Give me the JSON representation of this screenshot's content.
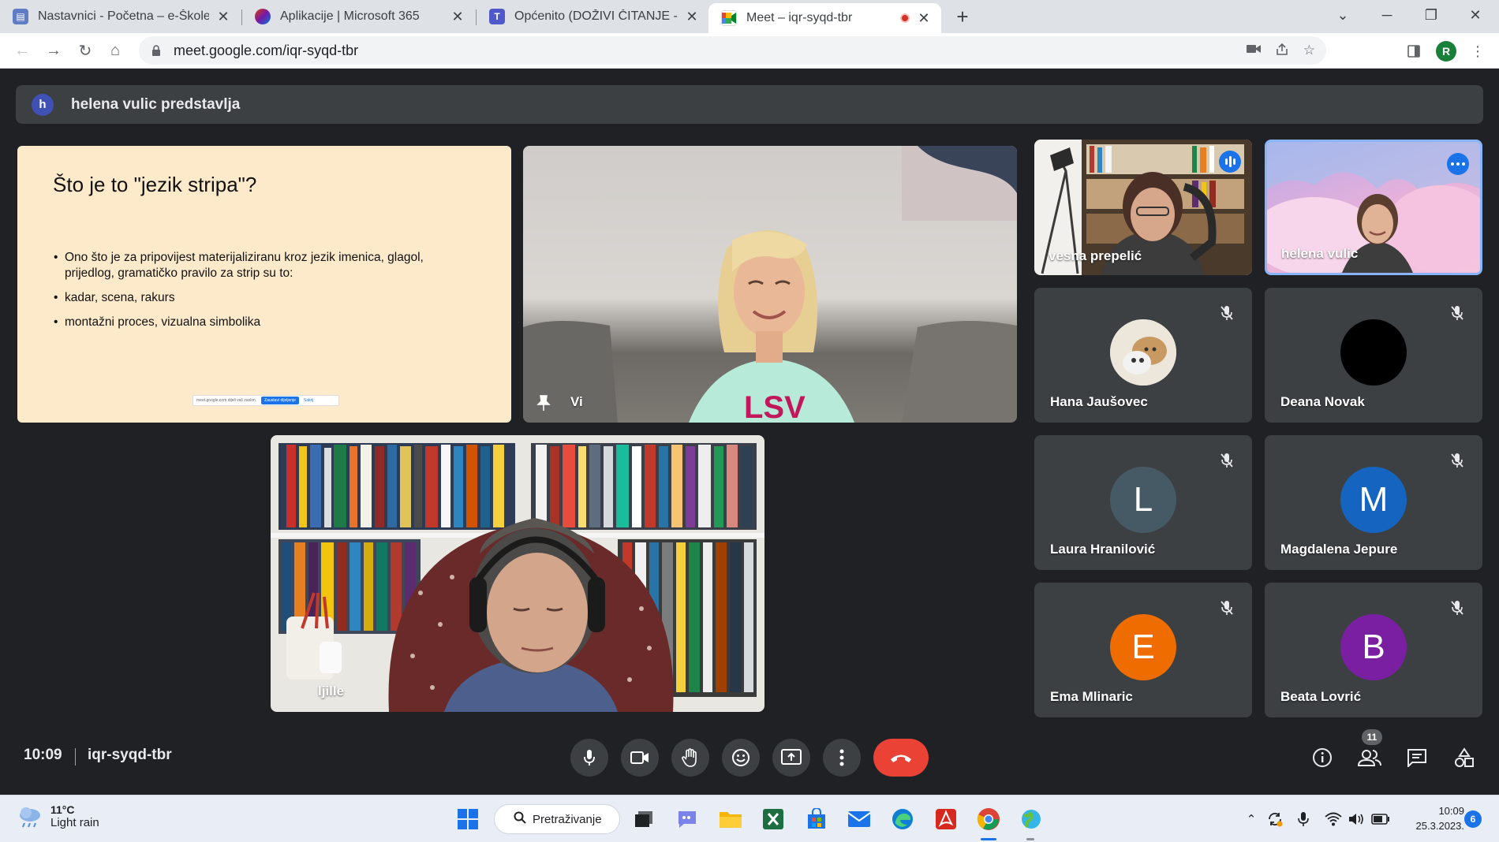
{
  "browser": {
    "tabs": [
      {
        "title": "Nastavnici - Početna – e-Škole",
        "active": false
      },
      {
        "title": "Aplikacije | Microsoft 365",
        "active": false
      },
      {
        "title": "Općenito (DOŽIVI ČITANJE - UČE",
        "active": false
      },
      {
        "title": "Meet – iqr-syqd-tbr",
        "active": true,
        "recording": true
      }
    ],
    "url": "meet.google.com/iqr-syqd-tbr",
    "profile_initial": "R"
  },
  "meet": {
    "presenting_banner": "helena vulic predstavlja",
    "presenter_initial": "h",
    "slide": {
      "title": "Što je to \"jezik stripa\"?",
      "bullets": [
        "Ono što je za pripovijest materijaliziranu kroz jezik imenica, glagol, prijedlog, gramatičko pravilo za strip su to:",
        "kadar, scena, rakurs",
        "montažni proces, vizualna simbolika"
      ],
      "share_bar": {
        "text": "meet.google.com dijeli vaš zaslon.",
        "stop": "Zaustavi dijeljenje",
        "hide": "Sakrij"
      }
    },
    "participants": {
      "you": "Vi",
      "ljille": "ljille",
      "vesna": "vesna prepelić",
      "helena": "helena vulic",
      "hana": "Hana Jaušovec",
      "deana": "Deana Novak",
      "laura": {
        "name": "Laura Hranilović",
        "initial": "L",
        "color": "#455a64"
      },
      "magdalena": {
        "name": "Magdalena Jepure",
        "initial": "M",
        "color": "#1565c0"
      },
      "ema": {
        "name": "Ema Mlinaric",
        "initial": "E",
        "color": "#ef6c00"
      },
      "beata": {
        "name": "Beata Lovrić",
        "initial": "B",
        "color": "#7b1fa2"
      }
    },
    "bottom": {
      "time": "10:09",
      "meeting_code": "iqr-syqd-tbr",
      "participant_count": "11"
    }
  },
  "taskbar": {
    "temperature": "11°C",
    "condition": "Light rain",
    "search_label": "Pretraživanje",
    "time": "10:09",
    "date": "25.3.2023.",
    "notifications": "6"
  }
}
